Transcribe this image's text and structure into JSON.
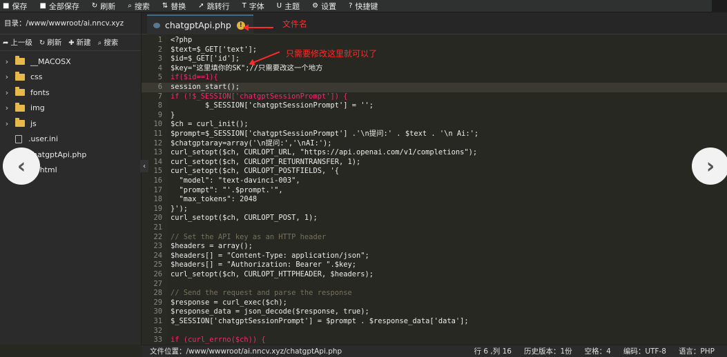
{
  "toolbar": {
    "items": [
      {
        "icon": "save-icon",
        "glyph": "■",
        "label": "保存"
      },
      {
        "icon": "save-all-icon",
        "glyph": "■",
        "label": "全部保存"
      },
      {
        "icon": "refresh-icon",
        "glyph": "↻",
        "label": "刷新"
      },
      {
        "icon": "search-icon",
        "glyph": "⌕",
        "label": "搜索"
      },
      {
        "icon": "replace-icon",
        "glyph": "⇅",
        "label": "替换"
      },
      {
        "icon": "goto-line-icon",
        "glyph": "➚",
        "label": "跳转行"
      },
      {
        "icon": "font-icon",
        "glyph": "T",
        "label": "字体"
      },
      {
        "icon": "theme-icon",
        "glyph": "U",
        "label": "主题"
      },
      {
        "icon": "gear-icon",
        "glyph": "⚙",
        "label": "设置"
      },
      {
        "icon": "help-icon",
        "glyph": "?",
        "label": "快捷键"
      }
    ]
  },
  "sidebar": {
    "dir_label": "目录：/www/wwwroot/ai.nncv.xyz",
    "tools": {
      "up": "上一级",
      "refresh": "刷新",
      "new": "新建",
      "search": "搜索"
    },
    "items": [
      {
        "type": "folder",
        "name": "__MACOSX"
      },
      {
        "type": "folder",
        "name": "css"
      },
      {
        "type": "folder",
        "name": "fonts"
      },
      {
        "type": "folder",
        "name": "img"
      },
      {
        "type": "folder",
        "name": "js"
      },
      {
        "type": "file",
        "name": ".user.ini"
      },
      {
        "type": "file",
        "name": "chatgptApi.php"
      },
      {
        "type": "file",
        "name": "ex.html"
      }
    ]
  },
  "tab": {
    "name": "chatgptApi.php",
    "warn": "!"
  },
  "annotations": {
    "file_name": "文件名",
    "modify_hint": "只需要修改这里就可以了"
  },
  "code_lines": [
    {
      "n": "1",
      "text": "<?php"
    },
    {
      "n": "2",
      "text": "$text=$_GET['text'];"
    },
    {
      "n": "3",
      "text": "$id=$_GET['id'];"
    },
    {
      "n": "4",
      "text": "$key=\"这里填你的SK\";//只需要改这一个地方"
    },
    {
      "n": "5",
      "text": "if($id==1){"
    },
    {
      "n": "6",
      "text": "session_start();"
    },
    {
      "n": "7",
      "text": "if (!$_SESSION['chatgptSessionPrompt']) {"
    },
    {
      "n": "8",
      "text": "        $_SESSION['chatgptSessionPrompt'] = '';"
    },
    {
      "n": "9",
      "text": "}"
    },
    {
      "n": "10",
      "text": "$ch = curl_init();"
    },
    {
      "n": "11",
      "text": "$prompt=$_SESSION['chatgptSessionPrompt'] .'\\n提问:' . $text . '\\n Ai:';"
    },
    {
      "n": "12",
      "text": "$chatgptaray=array('\\n提问:','\\nAI:');"
    },
    {
      "n": "13",
      "text": "curl_setopt($ch, CURLOPT_URL, \"https://api.openai.com/v1/completions\");"
    },
    {
      "n": "14",
      "text": "curl_setopt($ch, CURLOPT_RETURNTRANSFER, 1);"
    },
    {
      "n": "15",
      "text": "curl_setopt($ch, CURLOPT_POSTFIELDS, '{"
    },
    {
      "n": "16",
      "text": "  \"model\": \"text-davinci-003\","
    },
    {
      "n": "17",
      "text": "  \"prompt\": \"'.$prompt.'\","
    },
    {
      "n": "18",
      "text": "  \"max_tokens\": 2048"
    },
    {
      "n": "19",
      "text": "}');"
    },
    {
      "n": "20",
      "text": "curl_setopt($ch, CURLOPT_POST, 1);"
    },
    {
      "n": "21",
      "text": ""
    },
    {
      "n": "22",
      "text": "// Set the API key as an HTTP header"
    },
    {
      "n": "23",
      "text": "$headers = array();"
    },
    {
      "n": "24",
      "text": "$headers[] = \"Content-Type: application/json\";"
    },
    {
      "n": "25",
      "text": "$headers[] = \"Authorization: Bearer \".$key;"
    },
    {
      "n": "26",
      "text": "curl_setopt($ch, CURLOPT_HTTPHEADER, $headers);"
    },
    {
      "n": "27",
      "text": ""
    },
    {
      "n": "28",
      "text": "// Send the request and parse the response"
    },
    {
      "n": "29",
      "text": "$response = curl_exec($ch);"
    },
    {
      "n": "30",
      "text": "$response_data = json_decode($response, true);"
    },
    {
      "n": "31",
      "text": "$_SESSION['chatgptSessionPrompt'] = $prompt . $response_data['data'];"
    },
    {
      "n": "32",
      "text": ""
    },
    {
      "n": "33",
      "text": "if (curl_errno($ch)) {"
    }
  ],
  "status": {
    "path": "文件位置：/www/wwwroot/ai.nncv.xyz/chatgptApi.php",
    "position": "行 6 ,列 16",
    "history": "历史版本：1份",
    "indent": "空格：4",
    "encoding": "编码：UTF-8",
    "language": "语言：PHP"
  },
  "nav": {
    "prev": "‹",
    "next": "›",
    "collapse": "‹"
  }
}
